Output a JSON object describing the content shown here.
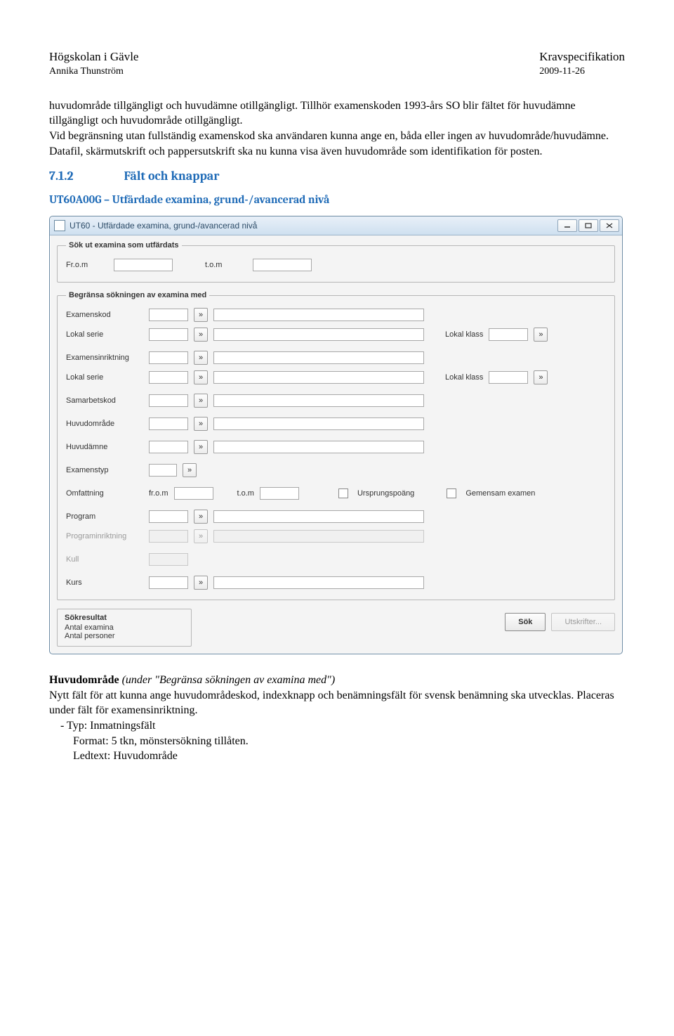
{
  "header": {
    "left1": "Högskolan i Gävle",
    "left2": "Annika Thunström",
    "right1": "Kravspecifikation",
    "right2": "2009-11-26"
  },
  "body": {
    "p1": "huvudområde tillgängligt och huvudämne otillgängligt. Tillhör examenskoden 1993-års SO blir fältet för huvudämne tillgängligt och huvudområde otillgängligt.",
    "p2": "Vid begränsning utan fullständig examenskod ska användaren kunna ange en, båda eller ingen av huvudområde/huvudämne.",
    "p3": "Datafil, skärmutskrift och pappersutskrift ska nu kunna visa även huvudområde som identifikation för posten."
  },
  "section": {
    "num": "7.1.2",
    "title": "Fält och knappar"
  },
  "subhead": "UT60A00G – Utfärdade examina, grund-/avancerad nivå",
  "dlg": {
    "title": "UT60 - Utfärdade examina, grund-/avancerad nivå",
    "legend1": "Sök ut examina som utfärdats",
    "from": "Fr.o.m",
    "to": "t.o.m",
    "legend2": "Begränsa sökningen av examina med",
    "examenskod": "Examenskod",
    "lokalserie": "Lokal serie",
    "lokalklass": "Lokal klass",
    "examensinr": "Examensinriktning",
    "samarbetskod": "Samarbetskod",
    "huvudomrade": "Huvudområde",
    "huvudamne": "Huvudämne",
    "examenstyp": "Examenstyp",
    "omf": "Omfattning",
    "omf_from": "fr.o.m",
    "omf_to": "t.o.m",
    "ursprung": "Ursprungspoäng",
    "gemensam": "Gemensam examen",
    "program": "Program",
    "programinr": "Programinriktning",
    "kull": "Kull",
    "kurs": "Kurs",
    "results_legend": "Sökresultat",
    "res1": "Antal examina",
    "res2": "Antal personer",
    "sok": "Sök",
    "utskr": "Utskrifter...",
    "idx": "»"
  },
  "lower": {
    "h3_bold": "Huvudområde",
    "h3_ital": " (under \"Begränsa sökningen av examina med\")",
    "p4": "Nytt fält för att kunna ange huvudområdeskod, indexknapp och benämningsfält för svensk benämning ska utvecklas. Placeras under fält för examensinriktning.",
    "dash": "-   Typ: Inmatningsfält",
    "fmt": "Format: 5 tkn, mönstersökning tillåten.",
    "led": "Ledtext: Huvudområde"
  }
}
